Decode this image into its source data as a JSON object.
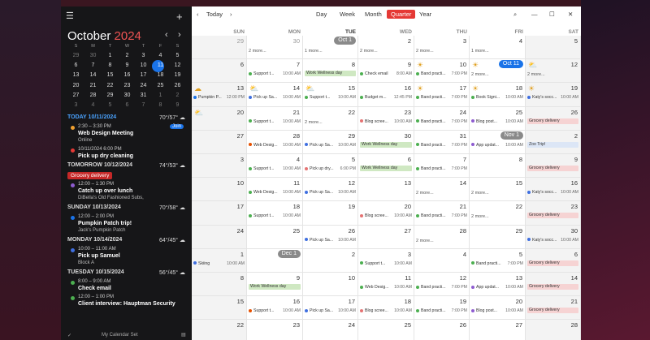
{
  "sidebar": {
    "month": "October",
    "year": "2024",
    "dows": [
      "S",
      "M",
      "T",
      "W",
      "T",
      "F",
      "S"
    ],
    "weeks": [
      [
        "29",
        "30",
        "1",
        "2",
        "3",
        "4",
        "5"
      ],
      [
        "6",
        "7",
        "8",
        "9",
        "10",
        "11",
        "12"
      ],
      [
        "13",
        "14",
        "15",
        "16",
        "17",
        "18",
        "19"
      ],
      [
        "20",
        "21",
        "22",
        "23",
        "24",
        "25",
        "26"
      ],
      [
        "27",
        "28",
        "29",
        "30",
        "31",
        "1",
        "2"
      ],
      [
        "3",
        "4",
        "5",
        "6",
        "7",
        "8",
        "9"
      ]
    ],
    "footer": "My Calendar Set"
  },
  "agenda": [
    {
      "head": "TODAY",
      "date": "10/11/2024",
      "weather": "70°/57°",
      "today": true
    },
    {
      "time": "2:30 – 3:30 PM",
      "title": "Web Design Meeting",
      "sub": "Online",
      "color": "#f0a030",
      "join": "Join"
    },
    {
      "time": "10/11/2024 6:00 PM",
      "title": "Pick up dry cleaning",
      "sub": "",
      "color": "#e53935"
    },
    {
      "head": "TOMORROW",
      "date": "10/12/2024",
      "weather": "74°/53°"
    },
    {
      "chip": "Grocery delivery"
    },
    {
      "time": "12:00 – 1:30 PM",
      "title": "Catch up over lunch",
      "sub": "DiBella's Old Fashioned Subs,",
      "color": "#8e5cd0"
    },
    {
      "head": "SUNDAY",
      "date": "10/13/2024",
      "weather": "70°/58°"
    },
    {
      "time": "12:00 – 2:00 PM",
      "title": "Pumpkin Patch trip!",
      "sub": "Jack's Pumpkin Patch",
      "color": "#1a73e8"
    },
    {
      "head": "MONDAY",
      "date": "10/14/2024",
      "weather": "64°/45°"
    },
    {
      "time": "10:00 – 11:00 AM",
      "title": "Pick up Samuel",
      "sub": "Block A",
      "color": "#3f6fe0"
    },
    {
      "head": "TUESDAY",
      "date": "10/15/2024",
      "weather": "56°/45°"
    },
    {
      "time": "8:00 – 9:00 AM",
      "title": "Check email",
      "sub": "",
      "color": "#4caf50"
    },
    {
      "time": "12:00 – 1:00 PM",
      "title": "Client interview: Hauptman Security",
      "sub": "",
      "color": "#4caf50"
    }
  ],
  "toolbar": {
    "today": "Today",
    "views": [
      "Day",
      "Week",
      "Month",
      "Quarter",
      "Year"
    ],
    "active": "Quarter"
  },
  "columns": [
    "SUN",
    "MON",
    "TUE",
    "WED",
    "THU",
    "FRI",
    "SAT"
  ],
  "cells": [
    {
      "r": 0,
      "c": 0,
      "d": "29",
      "dim": true
    },
    {
      "r": 0,
      "c": 1,
      "d": "30",
      "dim": true,
      "more": "2 more..."
    },
    {
      "r": 0,
      "c": 2,
      "pill": "Oct 1",
      "more": "1 more..."
    },
    {
      "r": 0,
      "c": 3,
      "d": "2",
      "more": "2 more..."
    },
    {
      "r": 0,
      "c": 4,
      "d": "3",
      "more": "2 more..."
    },
    {
      "r": 0,
      "c": 5,
      "d": "4",
      "more": "1 more..."
    },
    {
      "r": 0,
      "c": 6,
      "d": "5"
    },
    {
      "r": 1,
      "c": 0,
      "d": "6"
    },
    {
      "r": 1,
      "c": 1,
      "d": "7",
      "ev": [
        [
          "Support t...",
          "10:00 AM",
          "#4caf50"
        ]
      ]
    },
    {
      "r": 1,
      "c": 2,
      "d": "8",
      "bar": [
        "Work Wellness day",
        "g"
      ]
    },
    {
      "r": 1,
      "c": 3,
      "d": "9",
      "ev": [
        [
          "Check email",
          "8:00 AM",
          "#4caf50"
        ]
      ]
    },
    {
      "r": 1,
      "c": 4,
      "d": "10",
      "wx": "☀",
      "ev": [
        [
          "Band practi...",
          "7:00 PM",
          "#4caf50"
        ]
      ]
    },
    {
      "r": 1,
      "c": 5,
      "tpill": "Oct 11",
      "wx": "☀",
      "more": "2 more..."
    },
    {
      "r": 1,
      "c": 6,
      "d": "12",
      "wx": "⛅",
      "more": "2 more..."
    },
    {
      "r": 2,
      "c": 0,
      "d": "13",
      "wx": "☁",
      "ev": [
        [
          "Pumpkin P...",
          "12:00 PM",
          "#1a73e8"
        ]
      ]
    },
    {
      "r": 2,
      "c": 1,
      "d": "14",
      "wx": "⛅",
      "ev": [
        [
          "Pick up Sa...",
          "10:00 AM",
          "#3f6fe0"
        ]
      ]
    },
    {
      "r": 2,
      "c": 2,
      "d": "15",
      "wx": "⛅",
      "ev": [
        [
          "Support t...",
          "10:00 AM",
          "#4caf50"
        ]
      ]
    },
    {
      "r": 2,
      "c": 3,
      "d": "16",
      "ev": [
        [
          "Budget m...",
          "12:45 PM",
          "#4caf50"
        ]
      ]
    },
    {
      "r": 2,
      "c": 4,
      "d": "17",
      "wx": "☀",
      "ev": [
        [
          "Band practi...",
          "7:00 PM",
          "#4caf50"
        ]
      ]
    },
    {
      "r": 2,
      "c": 5,
      "d": "18",
      "wx": "☀",
      "ev": [
        [
          "Book Signi...",
          "10:00 AM",
          "#4caf50"
        ]
      ]
    },
    {
      "r": 2,
      "c": 6,
      "d": "19",
      "wx": "☀",
      "ev": [
        [
          "Katy's socc...",
          "10:00 AM",
          "#3f6fe0"
        ]
      ]
    },
    {
      "r": 3,
      "c": 0,
      "d": "20",
      "wx": "⛅"
    },
    {
      "r": 3,
      "c": 1,
      "d": "21",
      "ev": [
        [
          "Support t...",
          "10:00 AM",
          "#4caf50"
        ]
      ]
    },
    {
      "r": 3,
      "c": 2,
      "d": "22",
      "more": "2 more..."
    },
    {
      "r": 3,
      "c": 3,
      "d": "23",
      "ev": [
        [
          "Blog scree...",
          "10:00 AM",
          "#e57373"
        ]
      ]
    },
    {
      "r": 3,
      "c": 4,
      "d": "24",
      "ev": [
        [
          "Band practi...",
          "7:00 PM",
          "#4caf50"
        ]
      ]
    },
    {
      "r": 3,
      "c": 5,
      "d": "25",
      "ev": [
        [
          "Blog post...",
          "10:00 AM",
          "#8e5cd0"
        ]
      ]
    },
    {
      "r": 3,
      "c": 6,
      "d": "26",
      "bar": [
        "Grocery delivery",
        "r"
      ]
    },
    {
      "r": 4,
      "c": 0,
      "d": "27"
    },
    {
      "r": 4,
      "c": 1,
      "d": "28",
      "ev": [
        [
          "Web Desig...",
          "10:00 AM",
          "#e65100"
        ]
      ]
    },
    {
      "r": 4,
      "c": 2,
      "d": "29",
      "ev": [
        [
          "Pick up Sa...",
          "10:00 AM",
          "#3f6fe0"
        ]
      ]
    },
    {
      "r": 4,
      "c": 3,
      "d": "30",
      "bar": [
        "Work Wellness day",
        "g"
      ]
    },
    {
      "r": 4,
      "c": 4,
      "d": "31",
      "ev": [
        [
          "Band practi...",
          "7:00 PM",
          "#4caf50"
        ]
      ]
    },
    {
      "r": 4,
      "c": 5,
      "pill": "Nov 1",
      "ev": [
        [
          "App updat...",
          "10:00 AM",
          "#8e5cd0"
        ]
      ]
    },
    {
      "r": 4,
      "c": 6,
      "d": "2",
      "bar": [
        "Zoo Trip!",
        "b"
      ]
    },
    {
      "r": 5,
      "c": 0,
      "d": "3"
    },
    {
      "r": 5,
      "c": 1,
      "d": "4",
      "ev": [
        [
          "Support t...",
          "10:00 AM",
          "#4caf50"
        ]
      ]
    },
    {
      "r": 5,
      "c": 2,
      "d": "5",
      "ev": [
        [
          "Pick up dry...",
          "6:00 PM",
          "#e57373"
        ]
      ]
    },
    {
      "r": 5,
      "c": 3,
      "d": "6",
      "bar": [
        "Work Wellness day",
        "g"
      ]
    },
    {
      "r": 5,
      "c": 4,
      "d": "7",
      "ev": [
        [
          "Band practi...",
          "7:00 PM",
          "#4caf50"
        ]
      ]
    },
    {
      "r": 5,
      "c": 5,
      "d": "8"
    },
    {
      "r": 5,
      "c": 6,
      "d": "9",
      "bar": [
        "Grocery delivery",
        "r"
      ]
    },
    {
      "r": 6,
      "c": 0,
      "d": "10"
    },
    {
      "r": 6,
      "c": 1,
      "d": "11",
      "ev": [
        [
          "Web Desig...",
          "10:00 AM",
          "#4caf50"
        ]
      ]
    },
    {
      "r": 6,
      "c": 2,
      "d": "12",
      "ev": [
        [
          "Pick up Sa...",
          "10:00 AM",
          "#3f6fe0"
        ]
      ]
    },
    {
      "r": 6,
      "c": 3,
      "d": "13"
    },
    {
      "r": 6,
      "c": 4,
      "d": "14",
      "more": "2 more..."
    },
    {
      "r": 6,
      "c": 5,
      "d": "15",
      "more": "2 more..."
    },
    {
      "r": 6,
      "c": 6,
      "d": "16",
      "ev": [
        [
          "Katy's socc...",
          "10:00 AM",
          "#3f6fe0"
        ]
      ]
    },
    {
      "r": 7,
      "c": 0,
      "d": "17"
    },
    {
      "r": 7,
      "c": 1,
      "d": "18",
      "ev": [
        [
          "Support t...",
          "10:00 AM",
          "#4caf50"
        ]
      ]
    },
    {
      "r": 7,
      "c": 2,
      "d": "19"
    },
    {
      "r": 7,
      "c": 3,
      "d": "20",
      "ev": [
        [
          "Blog scree...",
          "10:00 AM",
          "#e57373"
        ]
      ]
    },
    {
      "r": 7,
      "c": 4,
      "d": "21",
      "ev": [
        [
          "Band practi...",
          "7:00 PM",
          "#4caf50"
        ]
      ]
    },
    {
      "r": 7,
      "c": 5,
      "d": "22",
      "more": "2 more..."
    },
    {
      "r": 7,
      "c": 6,
      "d": "23",
      "bar": [
        "Grocery delivery",
        "r"
      ]
    },
    {
      "r": 8,
      "c": 0,
      "d": "24"
    },
    {
      "r": 8,
      "c": 1,
      "d": "25"
    },
    {
      "r": 8,
      "c": 2,
      "d": "26",
      "ev": [
        [
          "Pick up Sa...",
          "10:00 AM",
          "#3f6fe0"
        ]
      ]
    },
    {
      "r": 8,
      "c": 3,
      "d": "27"
    },
    {
      "r": 8,
      "c": 4,
      "d": "28",
      "more": "2 more..."
    },
    {
      "r": 8,
      "c": 5,
      "d": "29"
    },
    {
      "r": 8,
      "c": 6,
      "d": "30",
      "ev": [
        [
          "Katy's socc...",
          "10:00 AM",
          "#3f6fe0"
        ]
      ]
    },
    {
      "r": 9,
      "c": 0,
      "d": "1",
      "ev": [
        [
          "Skiing",
          "10:00 AM",
          "#3f6fe0"
        ]
      ]
    },
    {
      "r": 9,
      "c": 1,
      "pill": "Dec 1"
    },
    {
      "r": 9,
      "c": 2,
      "d": "2"
    },
    {
      "r": 9,
      "c": 3,
      "d": "3",
      "ev": [
        [
          "Support t...",
          "10:00 AM",
          "#4caf50"
        ]
      ]
    },
    {
      "r": 9,
      "c": 4,
      "d": "4"
    },
    {
      "r": 9,
      "c": 5,
      "d": "5",
      "ev": [
        [
          "Band practi...",
          "7:00 PM",
          "#4caf50"
        ]
      ]
    },
    {
      "r": 9,
      "c": 6,
      "d": "6",
      "bar": [
        "Grocery delivery",
        "r"
      ]
    },
    {
      "r": 10,
      "c": 0,
      "d": "8"
    },
    {
      "r": 10,
      "c": 1,
      "d": "9",
      "bar": [
        "Work Wellness day",
        "g"
      ]
    },
    {
      "r": 10,
      "c": 2,
      "d": "10"
    },
    {
      "r": 10,
      "c": 3,
      "d": "11",
      "ev": [
        [
          "Web Desig...",
          "10:00 AM",
          "#4caf50"
        ]
      ]
    },
    {
      "r": 10,
      "c": 4,
      "d": "12",
      "ev": [
        [
          "Band practi...",
          "7:00 PM",
          "#4caf50"
        ]
      ]
    },
    {
      "r": 10,
      "c": 5,
      "d": "13",
      "ev": [
        [
          "App updat...",
          "10:00 AM",
          "#8e5cd0"
        ]
      ]
    },
    {
      "r": 10,
      "c": 6,
      "d": "14",
      "bar": [
        "Grocery delivery",
        "r"
      ]
    },
    {
      "r": 11,
      "c": 0,
      "d": "15"
    },
    {
      "r": 11,
      "c": 1,
      "d": "16",
      "ev": [
        [
          "Support t...",
          "10:00 AM",
          "#e65100"
        ]
      ]
    },
    {
      "r": 11,
      "c": 2,
      "d": "17",
      "ev": [
        [
          "Pick up Sa...",
          "10:00 AM",
          "#3f6fe0"
        ]
      ]
    },
    {
      "r": 11,
      "c": 3,
      "d": "18",
      "ev": [
        [
          "Blog scree...",
          "10:00 AM",
          "#e57373"
        ]
      ]
    },
    {
      "r": 11,
      "c": 4,
      "d": "19",
      "ev": [
        [
          "Band practi...",
          "7:00 PM",
          "#4caf50"
        ]
      ]
    },
    {
      "r": 11,
      "c": 5,
      "d": "20",
      "ev": [
        [
          "Blog post...",
          "10:00 AM",
          "#8e5cd0"
        ]
      ]
    },
    {
      "r": 11,
      "c": 6,
      "d": "21",
      "bar": [
        "Grocery delivery",
        "r"
      ]
    },
    {
      "r": 12,
      "c": 0,
      "d": "22"
    },
    {
      "r": 12,
      "c": 1,
      "d": "23"
    },
    {
      "r": 12,
      "c": 2,
      "d": "24"
    },
    {
      "r": 12,
      "c": 3,
      "d": "25"
    },
    {
      "r": 12,
      "c": 4,
      "d": "26"
    },
    {
      "r": 12,
      "c": 5,
      "d": "27"
    },
    {
      "r": 12,
      "c": 6,
      "d": "28"
    }
  ]
}
